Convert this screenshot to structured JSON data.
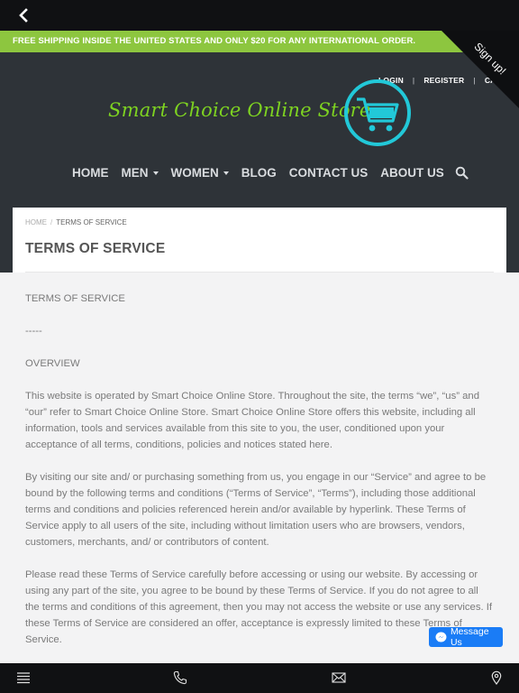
{
  "promo_text": "FREE SHIPPING INSIDE THE UNITED STATES AND ONLY $20 FOR ANY INTERNATIONAL ORDER.",
  "signup_label": "Sign up!",
  "account": {
    "login": "LOGIN",
    "register": "REGISTER",
    "cart": "CART"
  },
  "logo_text": "Smart Choice Online Store",
  "nav": {
    "home": "HOME",
    "men": "MEN",
    "women": "WOMEN",
    "blog": "BLOG",
    "contact": "CONTACT US",
    "about": "ABOUT US"
  },
  "breadcrumb": {
    "home": "HOME",
    "current": "TERMS OF SERVICE"
  },
  "page_title": "TERMS OF SERVICE",
  "content": {
    "heading": "TERMS OF SERVICE",
    "divider": "-----",
    "overview": "OVERVIEW",
    "p1": "This website is operated by Smart Choice Online Store. Throughout the site, the terms “we”, “us” and “our” refer to Smart Choice Online Store. Smart Choice Online Store offers this website, including all information, tools and services available from this site to you, the user, conditioned upon your acceptance of all terms, conditions, policies and notices stated here.",
    "p2": "By visiting our site and/ or purchasing something from us, you engage in our “Service” and agree to be bound by the following terms and conditions (“Terms of Service”, “Terms”), including those additional terms and conditions and policies referenced herein and/or available by hyperlink. These Terms of Service apply to all users of the site, including without limitation users who are browsers, vendors, customers, merchants, and/ or contributors of content.",
    "p3": "Please read these Terms of Service carefully before accessing or using our website. By accessing or using any part of the site, you agree to be bound by these Terms of Service. If you do not agree to all the terms and conditions of this agreement, then you may not access the website or use any services. If these Terms of Service are considered an offer, acceptance is expressly limited to these Terms of Service."
  },
  "message_button": "Message Us",
  "colors": {
    "promo": "#8dc63f",
    "header": "#2e3338",
    "logo": "#7ed321",
    "cart_ring": "#22c8d8",
    "messenger": "#1a7cf6"
  }
}
